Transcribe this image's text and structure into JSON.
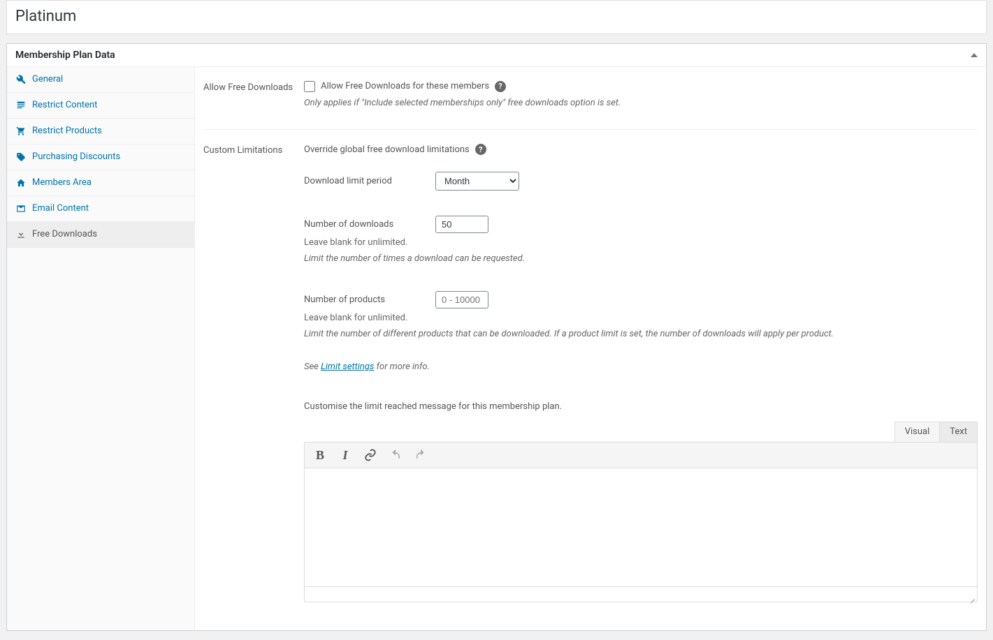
{
  "title": "Platinum",
  "metabox_title": "Membership Plan Data",
  "sidebar": {
    "items": [
      {
        "label": "General",
        "icon": "wrench-icon"
      },
      {
        "label": "Restrict Content",
        "icon": "content-icon"
      },
      {
        "label": "Restrict Products",
        "icon": "cart-icon"
      },
      {
        "label": "Purchasing Discounts",
        "icon": "tag-icon"
      },
      {
        "label": "Members Area",
        "icon": "home-icon"
      },
      {
        "label": "Email Content",
        "icon": "email-icon"
      },
      {
        "label": "Free Downloads",
        "icon": "download-icon"
      }
    ]
  },
  "main": {
    "allow_free_downloads": {
      "section_label": "Allow Free Downloads",
      "checkbox_label": "Allow Free Downloads for these members",
      "help": "Only applies if \"Include selected memberships only\" free downloads option is set."
    },
    "custom_limitations": {
      "section_label": "Custom Limitations",
      "heading": "Override global free download limitations",
      "period": {
        "label": "Download limit period",
        "value": "Month"
      },
      "downloads": {
        "label": "Number of downloads",
        "value": "50",
        "hint": "Leave blank for unlimited.",
        "description": "Limit the number of times a download can be requested."
      },
      "products": {
        "label": "Number of products",
        "placeholder": "0 - 10000",
        "hint": "Leave blank for unlimited.",
        "description": "Limit the number of different products that can be downloaded. If a product limit is set, the number of downloads will apply per product."
      },
      "see_more_prefix": "See ",
      "see_more_link": "Limit settings",
      "see_more_suffix": " for more info.",
      "customise_message": "Customise the limit reached message for this membership plan."
    },
    "editor": {
      "tab_visual": "Visual",
      "tab_text": "Text"
    }
  }
}
